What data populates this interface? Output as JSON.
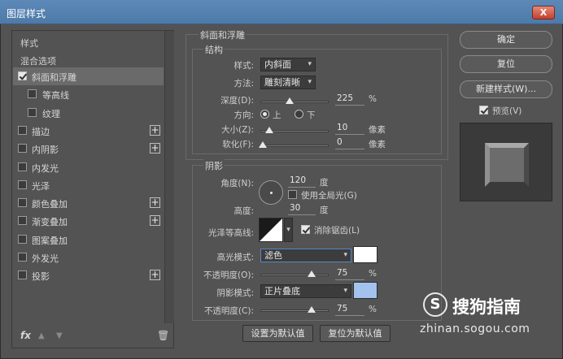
{
  "window": {
    "title": "图层样式",
    "close_label": "X"
  },
  "left_panel": {
    "header": "样式",
    "blend_options": "混合选项",
    "items": [
      {
        "label": "斜面和浮雕",
        "checked": true,
        "selected": true,
        "sub": false,
        "plus": false
      },
      {
        "label": "等高线",
        "checked": false,
        "selected": false,
        "sub": true,
        "plus": false
      },
      {
        "label": "纹理",
        "checked": false,
        "selected": false,
        "sub": true,
        "plus": false
      },
      {
        "label": "描边",
        "checked": false,
        "selected": false,
        "sub": false,
        "plus": true
      },
      {
        "label": "内阴影",
        "checked": false,
        "selected": false,
        "sub": false,
        "plus": true
      },
      {
        "label": "内发光",
        "checked": false,
        "selected": false,
        "sub": false,
        "plus": false
      },
      {
        "label": "光泽",
        "checked": false,
        "selected": false,
        "sub": false,
        "plus": false
      },
      {
        "label": "颜色叠加",
        "checked": false,
        "selected": false,
        "sub": false,
        "plus": true
      },
      {
        "label": "渐变叠加",
        "checked": false,
        "selected": false,
        "sub": false,
        "plus": true
      },
      {
        "label": "图案叠加",
        "checked": false,
        "selected": false,
        "sub": false,
        "plus": false
      },
      {
        "label": "外发光",
        "checked": false,
        "selected": false,
        "sub": false,
        "plus": false
      },
      {
        "label": "投影",
        "checked": false,
        "selected": false,
        "sub": false,
        "plus": true
      }
    ],
    "plus_symbol": "+",
    "fx_label": "fx",
    "up_arrow": "▲",
    "down_arrow": "▼",
    "trash_symbol": "🗑"
  },
  "bevel": {
    "section_title": "斜面和浮雕",
    "structure_title": "结构",
    "style_label": "样式:",
    "style_value": "内斜面",
    "method_label": "方法:",
    "method_value": "雕刻清晰",
    "depth_label": "深度(D):",
    "depth_value": "225",
    "depth_unit": "%",
    "direction_label": "方向:",
    "direction_up": "上",
    "direction_down": "下",
    "size_label": "大小(Z):",
    "size_value": "10",
    "size_unit": "像素",
    "soften_label": "软化(F):",
    "soften_value": "0",
    "soften_unit": "像素"
  },
  "shading": {
    "title": "阴影",
    "angle_label": "角度(N):",
    "angle_value": "120",
    "angle_unit": "度",
    "global_light_label": "使用全局光(G)",
    "altitude_label": "高度:",
    "altitude_value": "30",
    "altitude_unit": "度",
    "gloss_contour_label": "光泽等高线:",
    "anti_alias_label": "消除锯齿(L)",
    "highlight_mode_label": "高光模式:",
    "highlight_mode_value": "滤色",
    "highlight_opacity_label": "不透明度(O):",
    "highlight_opacity_value": "75",
    "shadow_mode_label": "阴影模式:",
    "shadow_mode_value": "正片叠底",
    "shadow_opacity_label": "不透明度(C):",
    "shadow_opacity_value": "75",
    "percent": "%",
    "highlight_color": "#ffffff",
    "shadow_color": "#a3c3ee"
  },
  "bottom_buttons": {
    "make_default": "设置为默认值",
    "reset_default": "复位为默认值"
  },
  "right": {
    "ok": "确定",
    "reset": "复位",
    "new_style": "新建样式(W)...",
    "preview_label": "预览(V)"
  },
  "watermark": {
    "logo": "S",
    "name": "搜狗指南",
    "url": "zhinan.sogou.com"
  },
  "colors": {
    "accent": "#4e7aa8",
    "panel_bg": "#535353"
  }
}
